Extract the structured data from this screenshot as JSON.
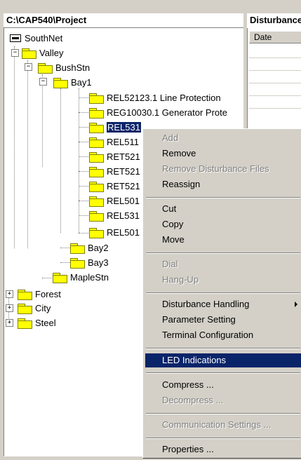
{
  "left_panel": {
    "title": "C:\\CAP540\\Project"
  },
  "right_panel": {
    "title": "Disturbance",
    "column_date": "Date"
  },
  "tree": {
    "root": "SouthNet",
    "valley": "Valley",
    "bushstn": "BushStn",
    "bay1": "Bay1",
    "ied1": "REL52123.1  Line Protection",
    "ied2": "REG10030.1  Generator Prote",
    "ied3": "REL531",
    "ied4": "REL511",
    "ied5": "RET521",
    "ied6": "RET521",
    "ied7": "RET521",
    "ied8": "REL501",
    "ied9": "REL531",
    "ied10": "REL501",
    "bay2": "Bay2",
    "bay3": "Bay3",
    "maplestn": "MapleStn",
    "forest": "Forest",
    "city": "City",
    "steel": "Steel",
    "expand_plus": "+",
    "expand_minus": "−"
  },
  "context_menu": {
    "add": "Add",
    "remove": "Remove",
    "remove_disturbance": "Remove Disturbance Files",
    "reassign": "Reassign",
    "cut": "Cut",
    "copy": "Copy",
    "move": "Move",
    "dial": "Dial",
    "hangup": "Hang-Up",
    "disturbance_handling": "Disturbance Handling",
    "parameter_setting": "Parameter Setting",
    "terminal_configuration": "Terminal Configuration",
    "led_indications": "LED Indications",
    "compress": "Compress ...",
    "decompress": "Decompress ...",
    "communication_settings": "Communication Settings ...",
    "properties": "Properties ..."
  },
  "colors": {
    "selection": "#0a246a",
    "folder": "#ffff00",
    "chrome": "#d4d0c8"
  }
}
